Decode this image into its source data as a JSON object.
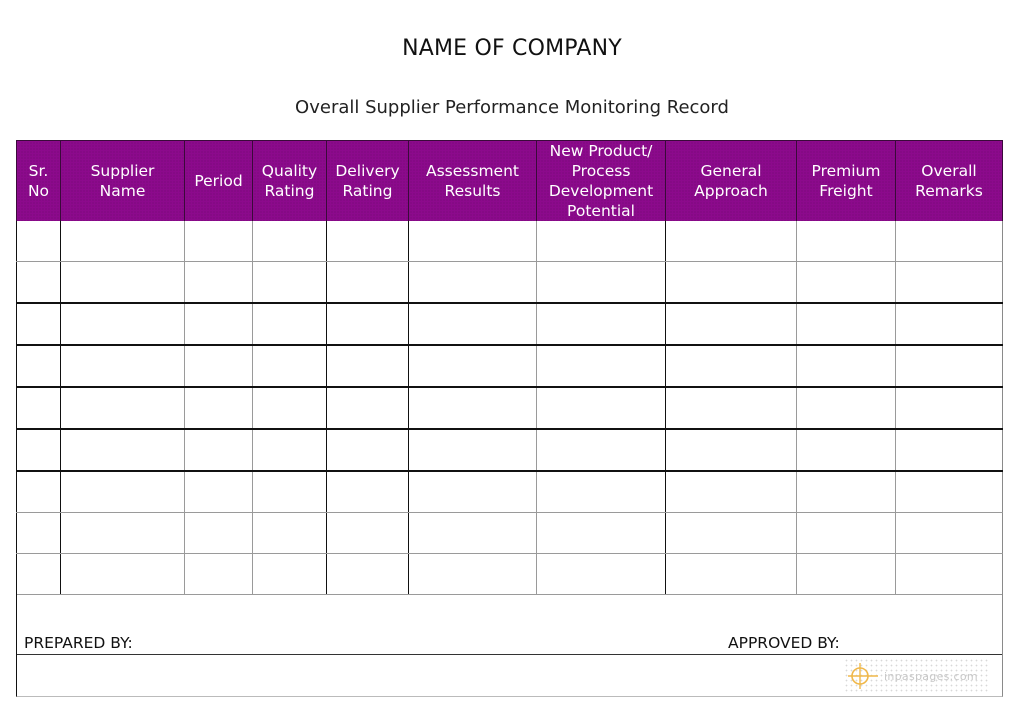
{
  "document": {
    "company_name": "NAME OF COMPANY",
    "title": "Overall Supplier Performance Monitoring Record"
  },
  "table": {
    "header_color": "#8c0a8c",
    "columns": [
      {
        "key": "sr_no",
        "lines": [
          "Sr.",
          "No"
        ]
      },
      {
        "key": "supplier_name",
        "lines": [
          "Supplier",
          "Name"
        ]
      },
      {
        "key": "period",
        "lines": [
          "Period"
        ]
      },
      {
        "key": "quality_rating",
        "lines": [
          "Quality",
          "Rating"
        ]
      },
      {
        "key": "delivery_rating",
        "lines": [
          "Delivery",
          "Rating"
        ]
      },
      {
        "key": "assessment_results",
        "lines": [
          "Assessment",
          "Results"
        ]
      },
      {
        "key": "new_product_process_development_potential",
        "lines": [
          "New Product/",
          "Process",
          "Development",
          "Potential"
        ]
      },
      {
        "key": "general_approach",
        "lines": [
          "General",
          "Approach"
        ]
      },
      {
        "key": "premium_freight",
        "lines": [
          "Premium",
          "Freight"
        ]
      },
      {
        "key": "overall_remarks",
        "lines": [
          "Overall",
          "Remarks"
        ]
      }
    ],
    "rows": [
      [
        "",
        "",
        "",
        "",
        "",
        "",
        "",
        "",
        "",
        ""
      ],
      [
        "",
        "",
        "",
        "",
        "",
        "",
        "",
        "",
        "",
        ""
      ],
      [
        "",
        "",
        "",
        "",
        "",
        "",
        "",
        "",
        "",
        ""
      ],
      [
        "",
        "",
        "",
        "",
        "",
        "",
        "",
        "",
        "",
        ""
      ],
      [
        "",
        "",
        "",
        "",
        "",
        "",
        "",
        "",
        "",
        ""
      ],
      [
        "",
        "",
        "",
        "",
        "",
        "",
        "",
        "",
        "",
        ""
      ],
      [
        "",
        "",
        "",
        "",
        "",
        "",
        "",
        "",
        "",
        ""
      ],
      [
        "",
        "",
        "",
        "",
        "",
        "",
        "",
        "",
        "",
        ""
      ],
      [
        "",
        "",
        "",
        "",
        "",
        "",
        "",
        "",
        "",
        ""
      ]
    ]
  },
  "footer": {
    "prepared_by_label": "PREPARED BY:",
    "approved_by_label": "APPROVED BY:",
    "watermark_text": "inpaspages.com",
    "watermark_icon": "crosshair-logo-icon"
  }
}
